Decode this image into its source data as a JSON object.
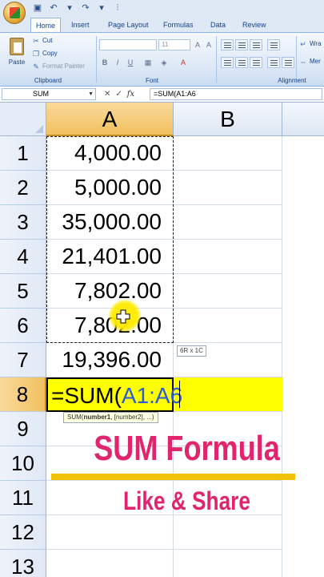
{
  "tabs": [
    "Home",
    "Insert",
    "Page Layout",
    "Formulas",
    "Data",
    "Review"
  ],
  "ribbon": {
    "clipboard": {
      "paste": "Paste",
      "cut": "Cut",
      "copy": "Copy",
      "format_painter": "Format Painter",
      "label": "Clipboard"
    },
    "font": {
      "size": "11",
      "label": "Font"
    },
    "alignment": {
      "wrap": "Wra",
      "merge": "Mer",
      "label": "Alignment"
    }
  },
  "formula_bar": {
    "name_box": "SUM",
    "formula": "=SUM(A1:A6"
  },
  "columns": [
    "A",
    "B"
  ],
  "rows": [
    "1",
    "2",
    "3",
    "4",
    "5",
    "6",
    "7",
    "8",
    "9",
    "10",
    "11",
    "12",
    "13"
  ],
  "cells_a": [
    "4,000.00",
    "5,000.00",
    "35,000.00",
    "21,401.00",
    "7,802.00",
    "7,802.00",
    "19,396.00"
  ],
  "active_cell": {
    "eq": "=SUM(",
    "ref": "A1:A6"
  },
  "range_tip": "6R x 1C",
  "fn_tip": {
    "name": "SUM(",
    "arg1": "number1",
    "rest": ", [number2], ...)"
  },
  "overlay": {
    "title": "SUM Formula",
    "subtitle": "Like & Share"
  },
  "colors": {
    "accent": "#e0256e",
    "highlight": "#ffff00",
    "bar": "#f2c200"
  }
}
